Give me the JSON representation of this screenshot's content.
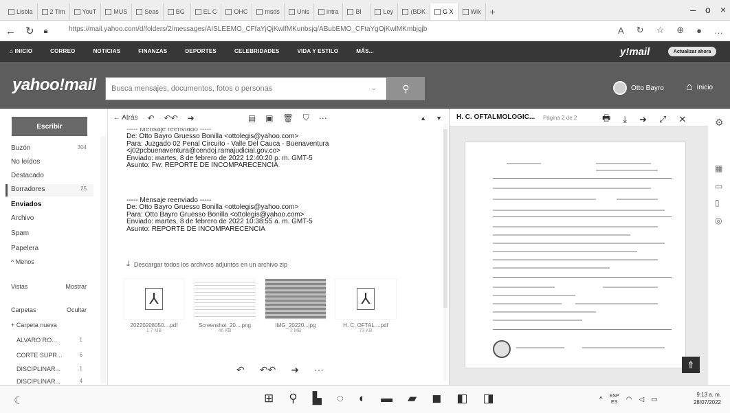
{
  "browser": {
    "tabs": [
      "Lisbla",
      "2 Tim",
      "YouT",
      "MUS",
      "Seas",
      "BG",
      "EL C",
      "OHC",
      "msds",
      "Unis",
      "intra",
      "Bl",
      "Ley",
      "(BDK",
      "G X",
      "Wik"
    ],
    "url": "https://mail.yahoo.com/d/folders/2/messages/AISLEEMO_CFfaYjQjKwlfMKunbsjq/ABubEMO_CFtaYgOjKwlMKmbjgjb",
    "url_host": "mail.yahoo.com",
    "win_ctrl": [
      "–",
      "o",
      "×"
    ],
    "addr_icons": [
      "A",
      "↻",
      "☆",
      "⊕",
      "●",
      "…"
    ]
  },
  "ynav": {
    "items": [
      "INICIO",
      "CORREO",
      "NOTICIAS",
      "FINANZAS",
      "DEPORTES",
      "CELEBRIDADES",
      "VIDA Y ESTILO",
      "MÁS..."
    ],
    "logo": "y!mail",
    "upgrade": "Actualizar ahora"
  },
  "header": {
    "logo": "yahoo!mail",
    "search_placeholder": "Busca mensajes, documentos, fotos o personas",
    "user_name": "Otto Bayro",
    "home_label": "Inicio"
  },
  "sidebar": {
    "compose": "Escribir",
    "folders": [
      {
        "label": "Buzón",
        "count": "304"
      },
      {
        "label": "No leídos",
        "count": ""
      },
      {
        "label": "Destacado",
        "count": ""
      },
      {
        "label": "Borradores",
        "count": "25"
      },
      {
        "label": "Enviados",
        "count": ""
      },
      {
        "label": "Archivo",
        "count": ""
      },
      {
        "label": "Spam",
        "count": ""
      },
      {
        "label": "Papelera",
        "count": ""
      },
      {
        "label": "^ Menos",
        "count": ""
      }
    ],
    "views": {
      "label": "Vistas",
      "action": "Mostrar"
    },
    "folders_header": {
      "label": "Carpetas",
      "action": "Ocultar"
    },
    "new_folder": "+ Carpeta nueva",
    "custom": [
      {
        "label": "ALVARO RO...",
        "count": "1"
      },
      {
        "label": "CORTE SUPR...",
        "count": "6"
      },
      {
        "label": "DISCIPLINAR...",
        "count": "1"
      },
      {
        "label": "DISCIPLINAR...",
        "count": "4"
      }
    ]
  },
  "message": {
    "back": "Atrás",
    "lines": [
      "----- Mensaje reenviado -----",
      "De: Otto Bayro Gruesso Bonilla <ottolegis@yahoo.com>",
      "Para: Juzgado 02 Penal Circuito - Valle Del Cauca - Buenaventura",
      "<j02pcbuenaventura@cendoj.ramajudicial.gov.co>",
      "Enviado: martes, 8 de febrero de 2022 12:40:20 p. m. GMT-5",
      "Asunto: Fw: REPORTE DE INCOMPARECENCIA",
      "",
      "",
      "",
      "----- Mensaje reenviado -----",
      "De: Otto Bayro Gruesso Bonilla <ottolegis@yahoo.com>",
      "Para: Otto Bayro Gruesso Bonilla <ottolegis@yahoo.com>",
      "Enviado: martes, 8 de febrero de 2022 10:38:55 a. m. GMT-5",
      "Asunto: REPORTE DE INCOMPARECENCIA"
    ],
    "download_all": "Descargar todos los archivos adjuntos en un archivo zip",
    "attachments": [
      {
        "name": "20220208050....pdf",
        "size": "1.7 MB"
      },
      {
        "name": "Screenshot_20....png",
        "size": "46 KB"
      },
      {
        "name": "IMG_20220...jpg",
        "size": "2 MB"
      },
      {
        "name": "H. C. OFTAL....pdf",
        "size": "73 KB"
      }
    ]
  },
  "pdf": {
    "title": "H. C. OFTALMOLOGIC...",
    "page": "Página  2  de 2"
  },
  "taskbar": {
    "lang": "ESP",
    "lang2": "ES",
    "time": "9:13 a. m.",
    "date": "28/07/2022"
  }
}
